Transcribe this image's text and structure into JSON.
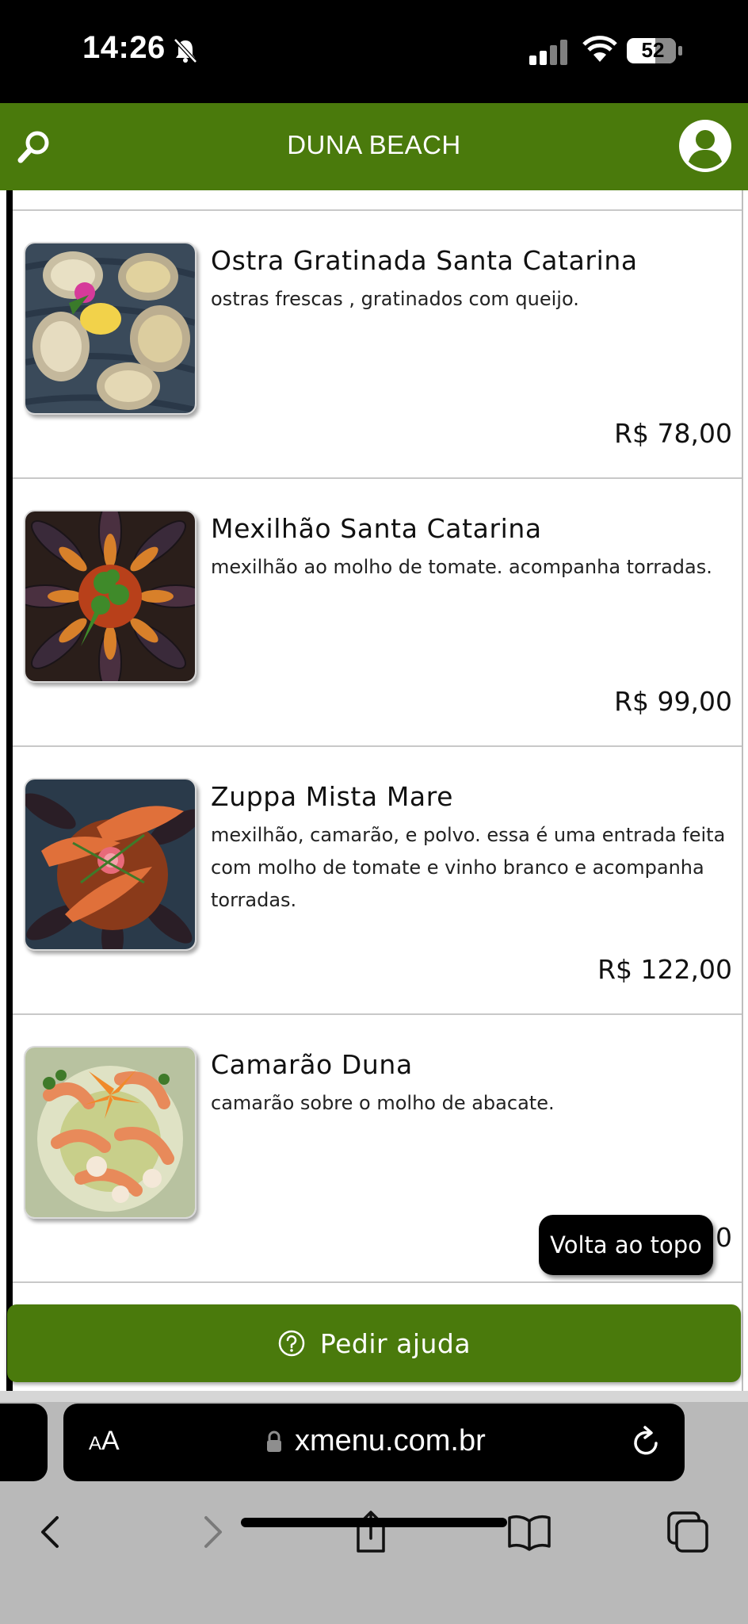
{
  "status_bar": {
    "time": "14:26",
    "battery": "52"
  },
  "header": {
    "title": "DUNA BEACH"
  },
  "items": [
    {
      "name": "Ostra Gratinada Santa Catarina",
      "description": "ostras frescas , gratinados com queijo.",
      "price": "R$ 78,00"
    },
    {
      "name": "Mexilhão Santa Catarina",
      "description": "mexilhão ao molho de tomate. acompanha torradas.",
      "price": "R$ 99,00"
    },
    {
      "name": "Zuppa Mista Mare",
      "description": "mexilhão, camarão, e polvo. essa é uma entrada feita com molho de tomate e vinho branco e acompanha torradas.",
      "price": "R$ 122,00"
    },
    {
      "name": "Camarão Duna",
      "description": "camarão sobre o molho de abacate.",
      "price": "0"
    }
  ],
  "back_to_top_label": "Volta ao topo",
  "help_button_label": "Pedir ajuda",
  "browser": {
    "aa_small": "A",
    "aa_large": "A",
    "url": "xmenu.com.br"
  },
  "colors": {
    "brand_green": "#4a7a0c"
  },
  "icons": [
    "bell-slash-icon",
    "cellular-icon",
    "wifi-icon",
    "battery-icon",
    "search-icon",
    "user-avatar-icon",
    "help-circle-icon",
    "lock-icon",
    "reload-icon",
    "back-icon",
    "forward-icon",
    "share-icon",
    "bookmarks-icon",
    "tabs-icon"
  ]
}
